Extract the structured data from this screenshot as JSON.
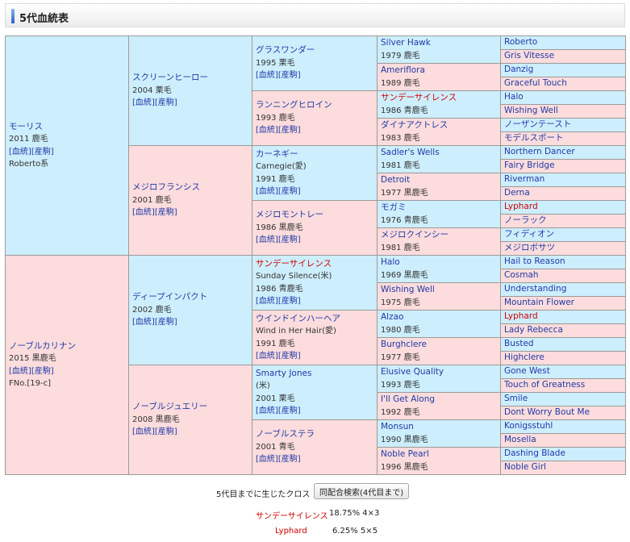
{
  "header": {
    "title": "5代血統表"
  },
  "links": {
    "pedigree": "[血統]",
    "foals": "[産駒]"
  },
  "gen1": [
    {
      "name": "モーリス",
      "year": "2011 鹿毛",
      "extra": "Roberto系"
    },
    {
      "name": "ノーブルカリナン",
      "year": "2015 黒鹿毛",
      "extra": "FNo.[19-c]"
    }
  ],
  "gen2": [
    {
      "name": "スクリーンヒーロー",
      "year": "2004 栗毛"
    },
    {
      "name": "メジロフランシス",
      "year": "2001 鹿毛"
    },
    {
      "name": "ディープインパクト",
      "year": "2002 鹿毛"
    },
    {
      "name": "ノーブルジュエリー",
      "year": "2008 黒鹿毛"
    }
  ],
  "gen3": [
    {
      "name": "グラスワンダー",
      "alt": "",
      "year": "1995 栗毛"
    },
    {
      "name": "ランニングヒロイン",
      "alt": "",
      "year": "1993 鹿毛"
    },
    {
      "name": "カーネギー",
      "alt": "Carnegie(愛)",
      "year": "1991 鹿毛"
    },
    {
      "name": "メジロモントレー",
      "alt": "",
      "year": "1986 黒鹿毛"
    },
    {
      "name": "サンデーサイレンス",
      "alt": "Sunday Silence(米)",
      "year": "1986 青鹿毛"
    },
    {
      "name": "ウインドインハーヘア",
      "alt": "Wind in Her Hair(愛)",
      "year": "1991 鹿毛"
    },
    {
      "name": "Smarty Jones",
      "alt": "(米)",
      "year": "2001 栗毛"
    },
    {
      "name": "ノーブルステラ",
      "alt": "",
      "year": "2001 青毛"
    }
  ],
  "gen4": [
    {
      "name": "Silver Hawk",
      "year": "1979 鹿毛"
    },
    {
      "name": "Ameriflora",
      "year": "1989 鹿毛"
    },
    {
      "name": "サンデーサイレンス",
      "year": "1986 青鹿毛"
    },
    {
      "name": "ダイナアクトレス",
      "year": "1983 鹿毛"
    },
    {
      "name": "Sadler's Wells",
      "year": "1981 鹿毛"
    },
    {
      "name": "Detroit",
      "year": "1977 黒鹿毛"
    },
    {
      "name": "モガミ",
      "year": "1976 青鹿毛"
    },
    {
      "name": "メジロクインシー",
      "year": "1981 鹿毛"
    },
    {
      "name": "Halo",
      "year": "1969 黒鹿毛"
    },
    {
      "name": "Wishing Well",
      "year": "1975 鹿毛"
    },
    {
      "name": "Alzao",
      "year": "1980 鹿毛"
    },
    {
      "name": "Burghclere",
      "year": "1977 鹿毛"
    },
    {
      "name": "Elusive Quality",
      "year": "1993 鹿毛"
    },
    {
      "name": "I'll Get Along",
      "year": "1992 鹿毛"
    },
    {
      "name": "Monsun",
      "year": "1990 黒鹿毛"
    },
    {
      "name": "Noble Pearl",
      "year": "1996 黒鹿毛"
    }
  ],
  "gen5": [
    "Roberto",
    "Gris Vitesse",
    "Danzig",
    "Graceful Touch",
    "Halo",
    "Wishing Well",
    "ノーザンテースト",
    "モデルスポート",
    "Northern Dancer",
    "Fairy Bridge",
    "Riverman",
    "Derna",
    "Lyphard",
    "ノーラック",
    "フィディオン",
    "メジロボサツ",
    "Hail to Reason",
    "Cosmah",
    "Understanding",
    "Mountain Flower",
    "Lyphard",
    "Lady Rebecca",
    "Busted",
    "Highclere",
    "Gone West",
    "Touch of Greatness",
    "Smile",
    "Dont Worry Bout Me",
    "Konigsstuhl",
    "Mosella",
    "Dashing Blade",
    "Noble Girl"
  ],
  "cross": {
    "label": "5代目までに生じたクロス",
    "button": "同配合検索(4代目まで)",
    "rows": [
      {
        "name": "サンデーサイレンス",
        "value": "18.75% 4×3"
      },
      {
        "name": "Lyphard",
        "value": "6.25% 5×5"
      }
    ]
  }
}
